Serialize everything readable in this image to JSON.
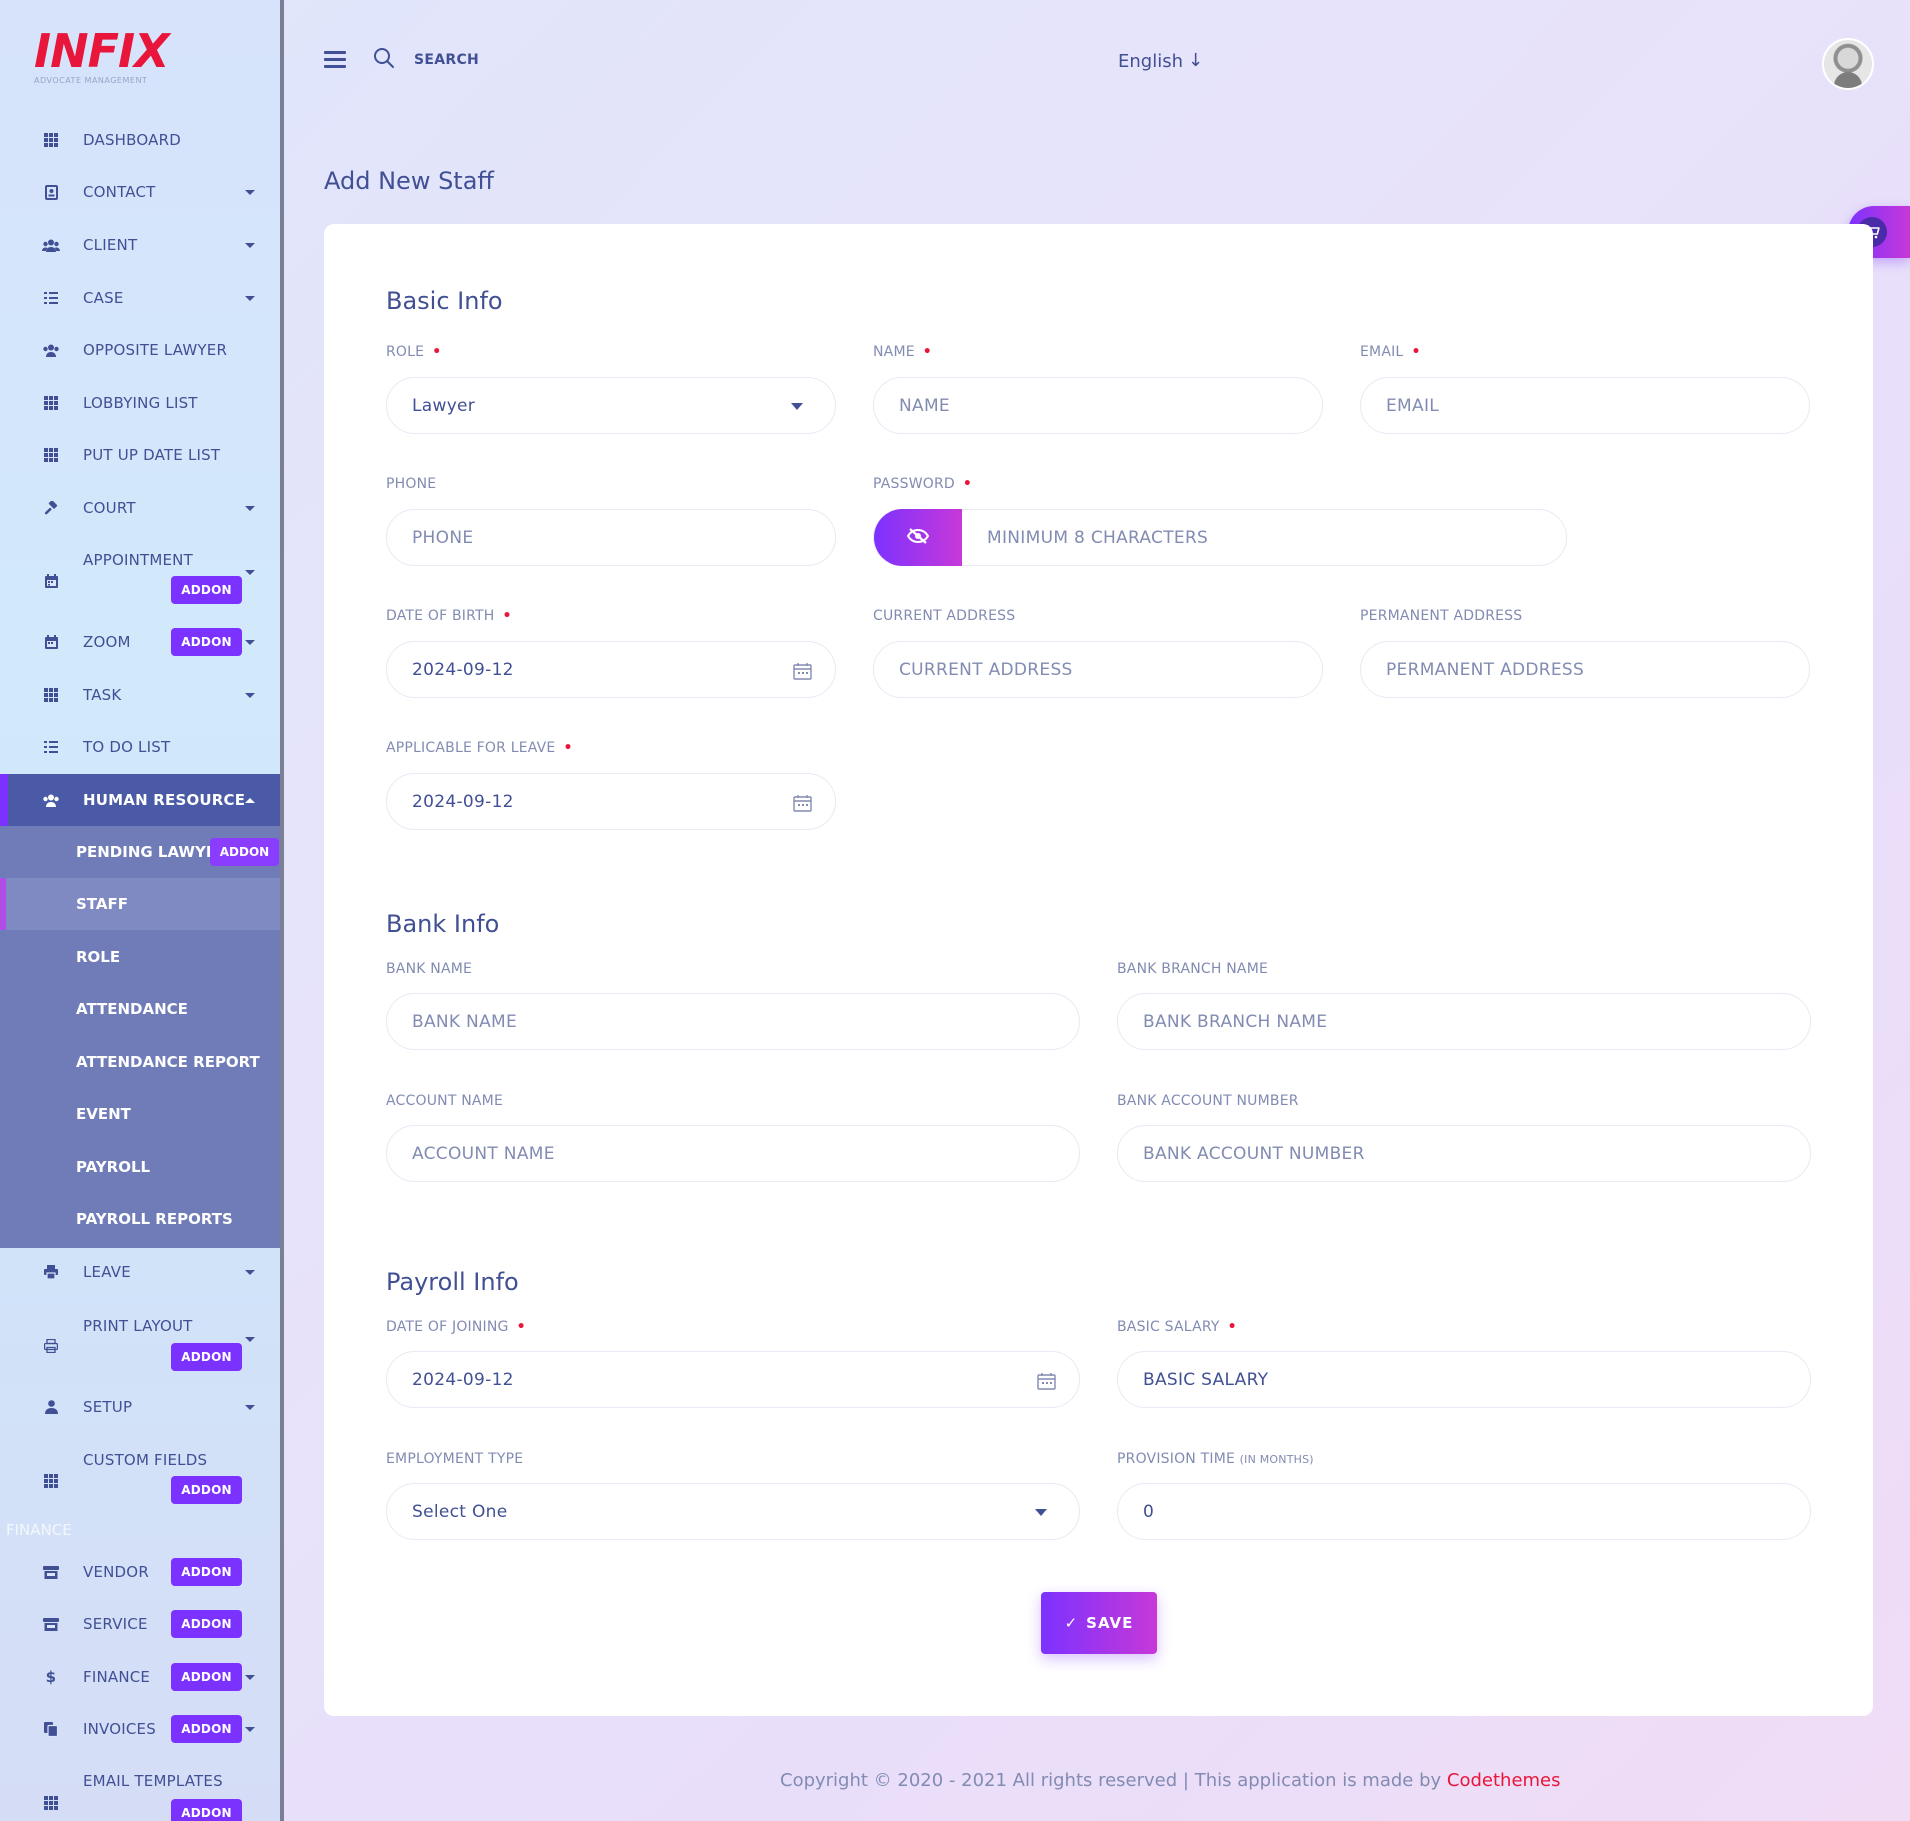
{
  "brand": {
    "logo_text": "INFIX",
    "logo_sub": "ADVOCATE MANAGEMENT"
  },
  "sidebar": {
    "items": [
      {
        "label": "DASHBOARD",
        "icon": "grid-icon"
      },
      {
        "label": "CONTACT",
        "icon": "contact-icon",
        "caret": true
      },
      {
        "label": "CLIENT",
        "icon": "users-icon",
        "caret": true
      },
      {
        "label": "CASE",
        "icon": "list-icon",
        "caret": true
      },
      {
        "label": "OPPOSITE LAWYER",
        "icon": "users-icon"
      },
      {
        "label": "LOBBYING LIST",
        "icon": "grid-icon"
      },
      {
        "label": "PUT UP DATE LIST",
        "icon": "grid-icon"
      },
      {
        "label": "COURT",
        "icon": "gavel-icon",
        "caret": true
      },
      {
        "label": "APPOINTMENT",
        "icon": "calendar-icon",
        "caret": true,
        "badge": "ADDON"
      },
      {
        "label": "ZOOM",
        "icon": "calendar-icon",
        "caret": true,
        "badge": "ADDON"
      },
      {
        "label": "TASK",
        "icon": "grid-icon",
        "caret": true
      },
      {
        "label": "TO DO LIST",
        "icon": "list-icon"
      },
      {
        "label": "HUMAN RESOURCE",
        "icon": "users-icon",
        "caret": true
      }
    ],
    "hr_submenu": [
      {
        "label": "PENDING LAWYER",
        "badge": "ADDON"
      },
      {
        "label": "STAFF"
      },
      {
        "label": "ROLE"
      },
      {
        "label": "ATTENDANCE"
      },
      {
        "label": "ATTENDANCE REPORT"
      },
      {
        "label": "EVENT"
      },
      {
        "label": "PAYROLL"
      },
      {
        "label": "PAYROLL REPORTS"
      }
    ],
    "items_after": [
      {
        "label": "LEAVE",
        "icon": "print-icon",
        "caret": true
      },
      {
        "label": "PRINT LAYOUT",
        "icon": "printer-icon",
        "caret": true,
        "badge": "ADDON"
      },
      {
        "label": "SETUP",
        "icon": "user-icon",
        "caret": true
      },
      {
        "label": "CUSTOM FIELDS",
        "icon": "grid-icon",
        "badge": "ADDON"
      }
    ],
    "finance_heading": "FINANCE",
    "finance_items": [
      {
        "label": "VENDOR",
        "icon": "store-icon",
        "badge": "ADDON"
      },
      {
        "label": "SERVICE",
        "icon": "store-icon",
        "badge": "ADDON"
      },
      {
        "label": "FINANCE",
        "icon": "dollar-icon",
        "badge": "ADDON",
        "caret": true
      },
      {
        "label": "INVOICES",
        "icon": "copy-icon",
        "badge": "ADDON",
        "caret": true
      },
      {
        "label": "EMAIL TEMPLATES",
        "icon": "grid-icon",
        "badge": "ADDON"
      }
    ]
  },
  "header": {
    "search_label": "SEARCH",
    "language": "English",
    "language_arrow": "↓"
  },
  "page": {
    "title": "Add New Staff"
  },
  "form": {
    "basic_info": {
      "title": "Basic Info",
      "role": {
        "label": "ROLE",
        "value": "Lawyer"
      },
      "name": {
        "label": "NAME",
        "placeholder": "NAME"
      },
      "email": {
        "label": "EMAIL",
        "placeholder": "EMAIL"
      },
      "phone": {
        "label": "PHONE",
        "placeholder": "PHONE"
      },
      "password": {
        "label": "PASSWORD",
        "placeholder": "MINIMUM 8 CHARACTERS"
      },
      "dob": {
        "label": "DATE OF BIRTH",
        "value": "2024-09-12"
      },
      "current_address": {
        "label": "CURRENT ADDRESS",
        "placeholder": "CURRENT ADDRESS"
      },
      "permanent_address": {
        "label": "PERMANENT ADDRESS",
        "placeholder": "PERMANENT ADDRESS"
      },
      "leave": {
        "label": "APPLICABLE FOR LEAVE",
        "value": "2024-09-12"
      }
    },
    "bank_info": {
      "title": "Bank Info",
      "bank_name": {
        "label": "BANK NAME",
        "placeholder": "BANK NAME"
      },
      "branch_name": {
        "label": "BANK BRANCH NAME",
        "placeholder": "BANK BRANCH NAME"
      },
      "account_name": {
        "label": "ACCOUNT NAME",
        "placeholder": "ACCOUNT NAME"
      },
      "account_number": {
        "label": "BANK ACCOUNT NUMBER",
        "placeholder": "BANK ACCOUNT NUMBER"
      }
    },
    "payroll_info": {
      "title": "Payroll Info",
      "joining": {
        "label": "DATE OF JOINING",
        "value": "2024-09-12"
      },
      "salary": {
        "label": "BASIC SALARY",
        "placeholder": "BASIC SALARY"
      },
      "employment_type": {
        "label": "EMPLOYMENT TYPE",
        "value": "Select One"
      },
      "provision": {
        "label": "PROVISION TIME",
        "label_suffix": "(IN MONTHS)",
        "value": "0"
      }
    },
    "save_label": "SAVE",
    "save_icon": "✓"
  },
  "footer": {
    "text": "Copyright © 2020 - 2021 All rights reserved | This application is made by ",
    "brand": "Codethemes"
  },
  "colors": {
    "primary": "#415094",
    "accent": "#7c32ff",
    "accent2": "#c738d8",
    "danger": "#e8163a"
  }
}
